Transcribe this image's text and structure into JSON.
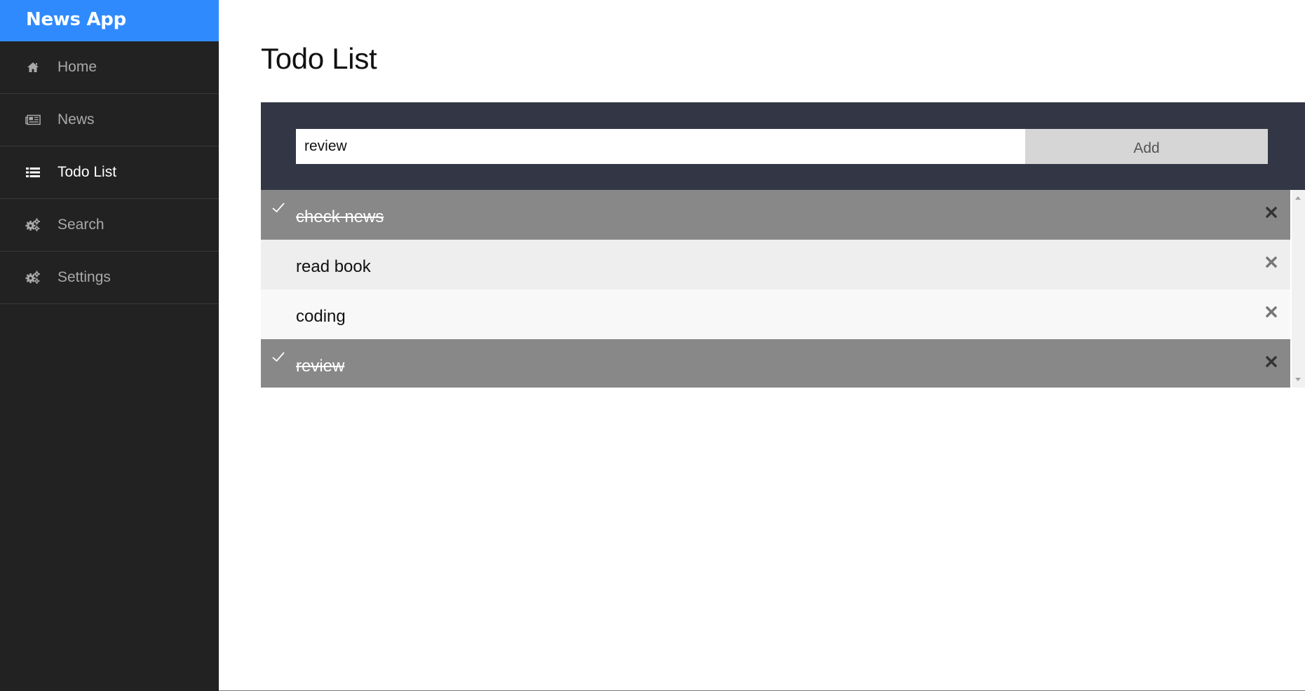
{
  "app": {
    "brand": "News App"
  },
  "sidebar": {
    "items": [
      {
        "label": "Home",
        "icon": "home-icon",
        "active": false
      },
      {
        "label": "News",
        "icon": "newspaper-icon",
        "active": false
      },
      {
        "label": "Todo List",
        "icon": "list-icon",
        "active": true
      },
      {
        "label": "Search",
        "icon": "gears-icon",
        "active": false
      },
      {
        "label": "Settings",
        "icon": "gears-icon",
        "active": false
      }
    ]
  },
  "main": {
    "title": "Todo List",
    "input": {
      "value": "review",
      "placeholder": ""
    },
    "add_label": "Add",
    "todos": [
      {
        "text": "check news",
        "done": true
      },
      {
        "text": "read book",
        "done": false
      },
      {
        "text": "coding",
        "done": false
      },
      {
        "text": "review",
        "done": true
      }
    ]
  },
  "colors": {
    "brand": "#2f8bfd",
    "sidebar_bg": "#222222",
    "panel_bg": "#333645",
    "done_bg": "#888888"
  }
}
